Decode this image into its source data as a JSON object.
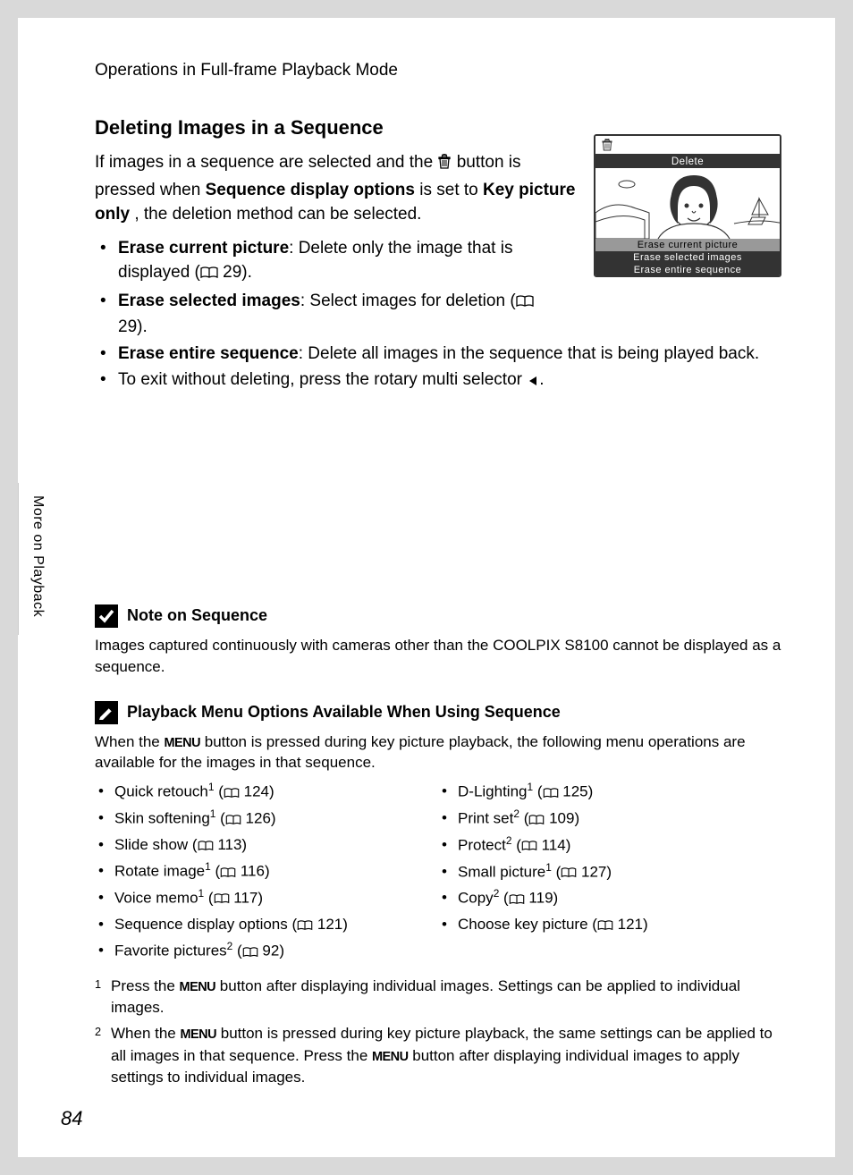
{
  "header": "Operations in Full-frame Playback Mode",
  "sideTab": "More on Playback",
  "pageNum": "84",
  "section": {
    "title": "Deleting Images in a Sequence",
    "intro1": "If images in a sequence are selected and the ",
    "intro2": " button is pressed when ",
    "intro_b1": "Sequence display options",
    "intro3": " is set to ",
    "intro_b2": "Key picture only",
    "intro4": ", the deletion method can be selected."
  },
  "bullets": {
    "b1_bold": "Erase current picture",
    "b1_text": ": Delete only the image that is displayed (",
    "b1_page": " 29).",
    "b2_bold": "Erase selected images",
    "b2_text": ": Select images for deletion (",
    "b2_page": " 29).",
    "b3_bold": "Erase entire sequence",
    "b3_text": ": Delete all images in the sequence that is being played back.",
    "b4_text1": "To exit without deleting, press the rotary multi selector ",
    "b4_text2": "."
  },
  "lcd": {
    "title": "Delete",
    "opt1": "Erase current picture",
    "opt2": "Erase selected images",
    "opt3": "Erase entire sequence"
  },
  "note": {
    "title": "Note on Sequence",
    "body": "Images captured continuously with cameras other than the COOLPIX S8100 cannot be displayed as a sequence."
  },
  "options": {
    "title": "Playback Menu Options Available When Using Sequence",
    "intro1": "When the ",
    "intro2": " button is pressed during key picture playback, the following menu operations are available for the images in that sequence.",
    "left": [
      {
        "label": "Quick retouch",
        "sup": "1",
        "page": " 124)"
      },
      {
        "label": "Skin softening",
        "sup": "1",
        "page": " 126)"
      },
      {
        "label": "Slide show (",
        "sup": "",
        "page": " 113)"
      },
      {
        "label": "Rotate image",
        "sup": "1",
        "page": " 116)"
      },
      {
        "label": "Voice memo",
        "sup": "1",
        "page": " 117)"
      },
      {
        "label": "Sequence display options (",
        "sup": "",
        "page": " 121)"
      },
      {
        "label": "Favorite pictures",
        "sup": "2",
        "page": " 92)"
      }
    ],
    "right": [
      {
        "label": "D-Lighting",
        "sup": "1",
        "page": " 125)"
      },
      {
        "label": "Print set",
        "sup": "2",
        "page": " 109)"
      },
      {
        "label": "Protect",
        "sup": "2",
        "page": " 114)"
      },
      {
        "label": "Small picture",
        "sup": "1",
        "page": " 127)"
      },
      {
        "label": "Copy",
        "sup": "2",
        "page": " 119)"
      },
      {
        "label": "Choose key picture (",
        "sup": "",
        "page": " 121)"
      }
    ]
  },
  "footnotes": {
    "f1a": "Press the ",
    "f1b": " button after displaying individual images. Settings can be applied to individual images.",
    "f2a": "When the ",
    "f2b": " button is pressed during key picture playback, the same settings can be applied to all images in that sequence. Press the ",
    "f2c": " button after displaying individual images to apply settings to individual images."
  },
  "menuWord": "MENU"
}
